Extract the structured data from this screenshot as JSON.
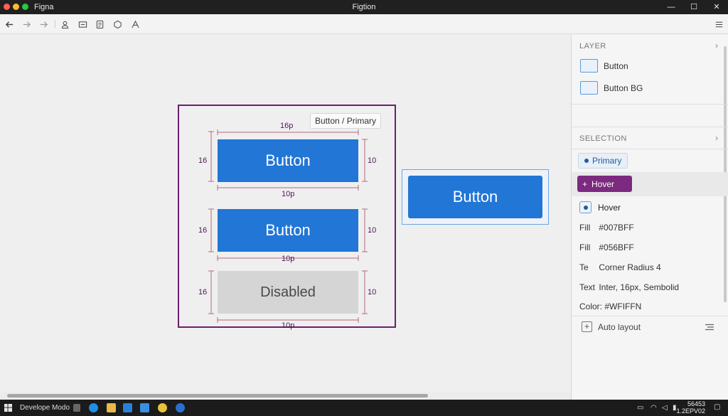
{
  "window": {
    "app_name": "Figna",
    "title": "Figtion",
    "controls": {
      "minimize": "—",
      "maximize": "☐",
      "close": "✕"
    }
  },
  "toolbar": {
    "icons": [
      "back-arrow-icon",
      "forward-arrow-icon",
      "redo-arrow-icon",
      "user-icon",
      "share-icon",
      "file-icon",
      "component-icon",
      "text-style-icon",
      "menu-icon"
    ]
  },
  "canvas": {
    "frame_label": "Button / Primary",
    "buttons": [
      {
        "label": "Button",
        "state": "primary",
        "color": "#2176D6"
      },
      {
        "label": "Button",
        "state": "primary",
        "color": "#2176D6"
      },
      {
        "label": "Disabled",
        "state": "disabled",
        "color": "#D5D5D5"
      }
    ],
    "measure_top": "16p",
    "measure_bottom": "10p",
    "measure_left": "16",
    "measure_right": "10",
    "preview_button_label": "Button"
  },
  "panel": {
    "layer_header": "LAYER",
    "layers": [
      "Button",
      "Button BG"
    ],
    "selection_header": "SELECTION",
    "variant_chip": "Primary",
    "hover_button": "Hover",
    "hover_option": "Hover",
    "props": [
      {
        "key": "Fill",
        "value": "#007BFF"
      },
      {
        "key": "Fill",
        "value": "#056BFF"
      },
      {
        "key": "Te",
        "value": "Corner Radius 4"
      },
      {
        "key": "Text",
        "value": "Inter, 16px, Sembolid"
      },
      {
        "key": "Color:",
        "value": "#WFIFFN"
      }
    ],
    "auto_layout": "Auto layout"
  },
  "taskbar": {
    "mode_label": "Develope Modo",
    "clock_line1": "56453",
    "clock_line2": "1.2EPV02"
  },
  "colors": {
    "frame": "#6B1F6E",
    "accent_blue": "#2176D6",
    "hover_purple": "#7B2A7F"
  }
}
